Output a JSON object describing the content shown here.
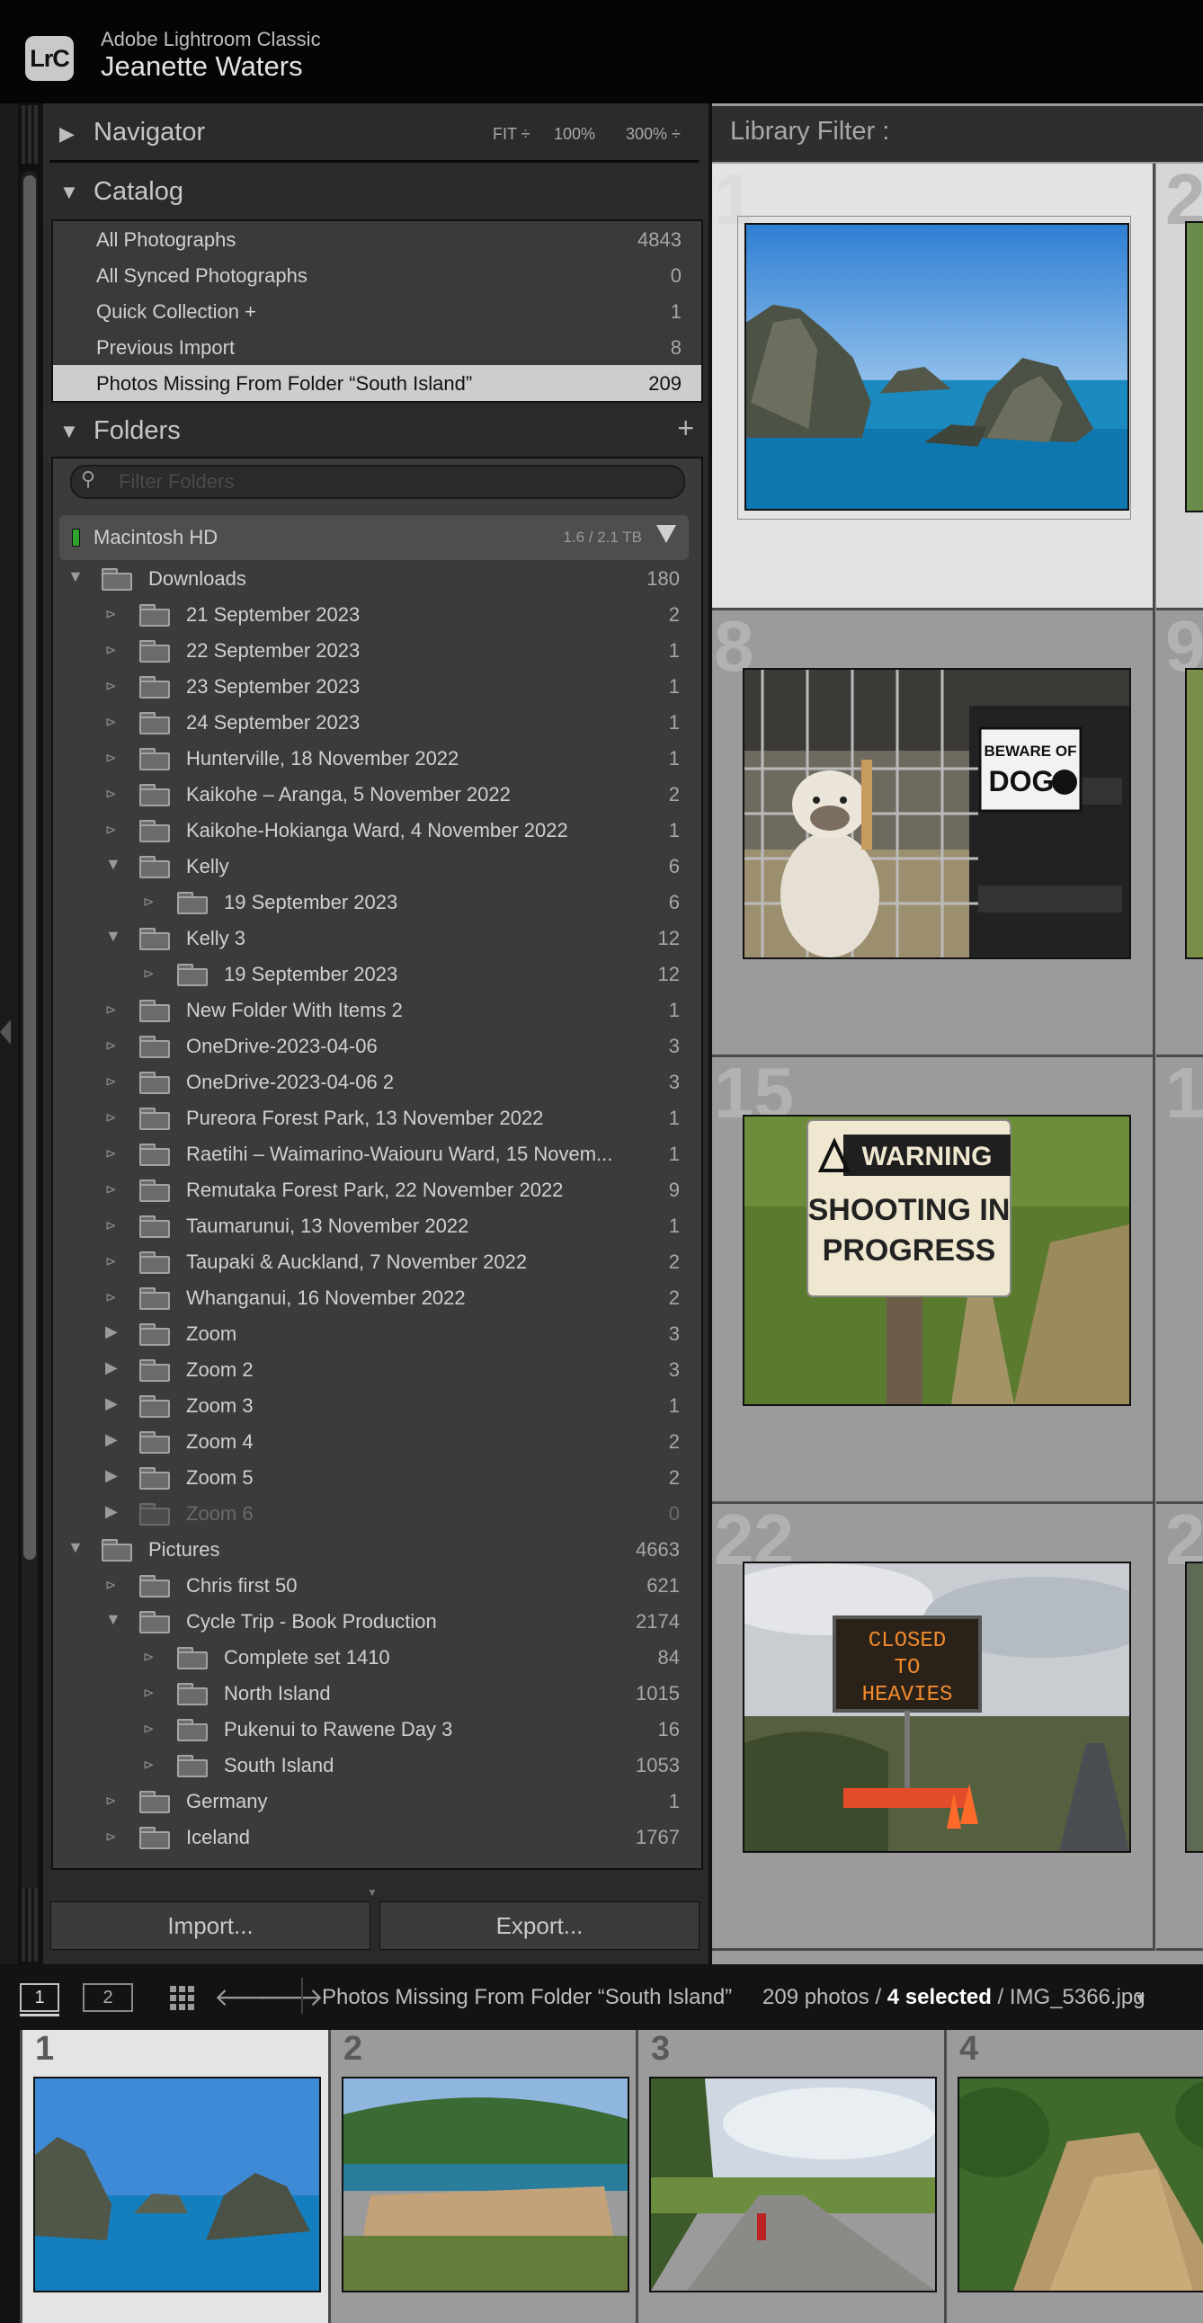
{
  "titlebar": {
    "logo": "LrC",
    "app_name": "Adobe Lightroom Classic",
    "user_name": "Jeanette Waters"
  },
  "navigator": {
    "title": "Navigator",
    "zoom_fit": "FIT ÷",
    "zoom_100": "100%",
    "zoom_300": "300% ÷"
  },
  "catalog": {
    "title": "Catalog",
    "items": [
      {
        "label": "All Photographs",
        "count": "4843"
      },
      {
        "label": "All Synced Photographs",
        "count": "0"
      },
      {
        "label": "Quick Collection +",
        "count": "1"
      },
      {
        "label": "Previous Import",
        "count": "8"
      },
      {
        "label": "Photos Missing From Folder “South Island”",
        "count": "209"
      }
    ]
  },
  "folders": {
    "title": "Folders",
    "add": "+",
    "filter_placeholder": "Filter Folders",
    "volume": {
      "name": "Macintosh HD",
      "space": "1.6 / 2.1 TB"
    },
    "rows": [
      {
        "name": "Downloads",
        "count": "180",
        "level": 0,
        "tri": "down"
      },
      {
        "name": "21 September 2023",
        "count": "2",
        "level": 1,
        "tri": "sub"
      },
      {
        "name": "22 September 2023",
        "count": "1",
        "level": 1,
        "tri": "sub"
      },
      {
        "name": "23 September 2023",
        "count": "1",
        "level": 1,
        "tri": "sub"
      },
      {
        "name": "24 September 2023",
        "count": "1",
        "level": 1,
        "tri": "sub"
      },
      {
        "name": "Hunterville, 18 November 2022",
        "count": "1",
        "level": 1,
        "tri": "sub"
      },
      {
        "name": "Kaikohe – Aranga, 5 November 2022",
        "count": "2",
        "level": 1,
        "tri": "sub"
      },
      {
        "name": "Kaikohe-Hokianga Ward, 4 November 2022",
        "count": "1",
        "level": 1,
        "tri": "sub"
      },
      {
        "name": "Kelly",
        "count": "6",
        "level": 1,
        "tri": "down"
      },
      {
        "name": "19 September 2023",
        "count": "6",
        "level": 2,
        "tri": "sub"
      },
      {
        "name": "Kelly 3",
        "count": "12",
        "level": 1,
        "tri": "down"
      },
      {
        "name": "19 September 2023",
        "count": "12",
        "level": 2,
        "tri": "sub"
      },
      {
        "name": "New Folder With Items 2",
        "count": "1",
        "level": 1,
        "tri": "sub"
      },
      {
        "name": "OneDrive-2023-04-06",
        "count": "3",
        "level": 1,
        "tri": "sub"
      },
      {
        "name": "OneDrive-2023-04-06 2",
        "count": "3",
        "level": 1,
        "tri": "sub"
      },
      {
        "name": "Pureora Forest Park, 13 November 2022",
        "count": "1",
        "level": 1,
        "tri": "sub"
      },
      {
        "name": "Raetihi – Waimarino-Waiouru Ward, 15 Novem...",
        "count": "1",
        "level": 1,
        "tri": "sub"
      },
      {
        "name": "Remutaka Forest Park, 22 November 2022",
        "count": "9",
        "level": 1,
        "tri": "sub"
      },
      {
        "name": "Taumarunui, 13 November 2022",
        "count": "1",
        "level": 1,
        "tri": "sub"
      },
      {
        "name": "Taupaki & Auckland, 7 November 2022",
        "count": "2",
        "level": 1,
        "tri": "sub"
      },
      {
        "name": "Whanganui, 16 November 2022",
        "count": "2",
        "level": 1,
        "tri": "sub"
      },
      {
        "name": "Zoom",
        "count": "3",
        "level": 1,
        "tri": "right"
      },
      {
        "name": "Zoom 2",
        "count": "3",
        "level": 1,
        "tri": "right"
      },
      {
        "name": "Zoom 3",
        "count": "1",
        "level": 1,
        "tri": "right"
      },
      {
        "name": "Zoom 4",
        "count": "2",
        "level": 1,
        "tri": "right"
      },
      {
        "name": "Zoom 5",
        "count": "2",
        "level": 1,
        "tri": "right"
      },
      {
        "name": "Zoom 6",
        "count": "0",
        "level": 1,
        "tri": "right",
        "dim": true
      },
      {
        "name": "Pictures",
        "count": "4663",
        "level": 0,
        "tri": "down"
      },
      {
        "name": "Chris first 50",
        "count": "621",
        "level": 1,
        "tri": "sub"
      },
      {
        "name": "Cycle Trip - Book Production",
        "count": "2174",
        "level": 1,
        "tri": "down"
      },
      {
        "name": "Complete set 1410",
        "count": "84",
        "level": 2,
        "tri": "sub"
      },
      {
        "name": "North Island",
        "count": "1015",
        "level": 2,
        "tri": "sub"
      },
      {
        "name": "Pukenui to Rawene Day 3",
        "count": "16",
        "level": 2,
        "tri": "sub"
      },
      {
        "name": "South Island",
        "count": "1053",
        "level": 2,
        "tri": "sub"
      },
      {
        "name": "Germany",
        "count": "1",
        "level": 1,
        "tri": "sub"
      },
      {
        "name": "Iceland",
        "count": "1767",
        "level": 1,
        "tri": "sub"
      }
    ]
  },
  "buttons": {
    "import": "Import...",
    "export": "Export..."
  },
  "library_filter": {
    "label": "Library Filter :"
  },
  "grid": {
    "cells": [
      {
        "num": "1",
        "photo": "islands",
        "selected": true
      },
      {
        "num": "8",
        "photo": "dog"
      },
      {
        "num": "15",
        "photo": "warning"
      },
      {
        "num": "22",
        "photo": "closed"
      }
    ],
    "peek_nums": [
      "2",
      "9",
      "1",
      "2"
    ],
    "sign_dog": [
      "BEWARE OF",
      "DOG"
    ],
    "sign_warning": [
      "WARNING",
      "SHOOTING IN",
      "PROGRESS"
    ],
    "sign_closed": [
      "CLOSED",
      "TO",
      "HEAVIES"
    ]
  },
  "statusbar": {
    "view1": "1",
    "view2": "2",
    "source": "Photos Missing From Folder “South Island”",
    "count_text": "209 photos /",
    "selected_text": "4 selected",
    "file_text": "/ IMG_5366.jpg"
  },
  "filmstrip": {
    "items": [
      {
        "num": "1",
        "photo": "islands",
        "selected": true
      },
      {
        "num": "2",
        "photo": "timber"
      },
      {
        "num": "3",
        "photo": "road"
      },
      {
        "num": "4",
        "photo": "bank"
      }
    ]
  }
}
